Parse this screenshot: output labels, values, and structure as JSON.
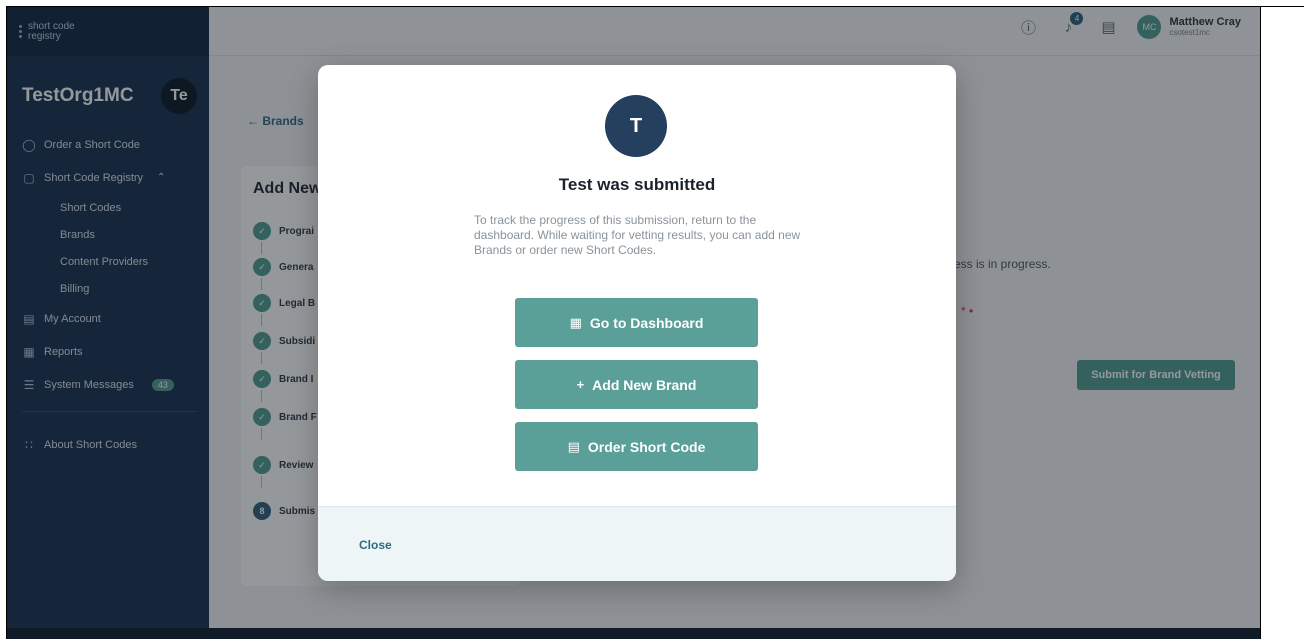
{
  "logo": {
    "line1": "short code",
    "line2": "registry"
  },
  "org": {
    "name": "TestOrg1MC",
    "avatar": "Te"
  },
  "sidebar": {
    "items": [
      {
        "label": "Order a Short Code",
        "icon": "tag-icon"
      },
      {
        "label": "Short Code Registry",
        "icon": "registry-icon"
      },
      {
        "label": "My Account",
        "icon": "account-icon"
      },
      {
        "label": "Reports",
        "icon": "reports-icon"
      },
      {
        "label": "System Messages",
        "icon": "messages-icon",
        "badge": "43"
      },
      {
        "label": "About Short Codes",
        "icon": "about-icon"
      }
    ],
    "subitems": [
      "Short Codes",
      "Brands",
      "Content Providers",
      "Billing"
    ]
  },
  "header": {
    "bell_count": "4",
    "user": {
      "initials": "MC",
      "name": "Matthew Cray",
      "sub": "csotest1mc"
    }
  },
  "main": {
    "back_label": "Brands",
    "card_title": "Add New",
    "steps": [
      {
        "marker": "",
        "label": "Prograi"
      },
      {
        "marker": "",
        "label": "Genera"
      },
      {
        "marker": "",
        "label": "Legal B"
      },
      {
        "marker": "",
        "label": "Subsidi"
      },
      {
        "marker": "",
        "label": "Brand I"
      },
      {
        "marker": "",
        "label": "Brand F"
      },
      {
        "marker": "",
        "label": "Review"
      },
      {
        "marker": "8",
        "label": "Submis"
      }
    ],
    "right_text": "ess is in progress.",
    "required_mark": "* •",
    "vet_button": "Submit for Brand Vetting"
  },
  "modal": {
    "avatar": "T",
    "title": "Test was submitted",
    "text": "To track the progress of this submission, return to the dashboard. While waiting for vetting results, you can add new Brands or order new Short Codes.",
    "buttons": {
      "dashboard": "Go to Dashboard",
      "add_brand": "Add New Brand",
      "order": "Order Short Code"
    },
    "close": "Close"
  },
  "colors": {
    "sidebar": "#16314f",
    "accent": "#5a9f98",
    "avatar": "#253f5e"
  }
}
